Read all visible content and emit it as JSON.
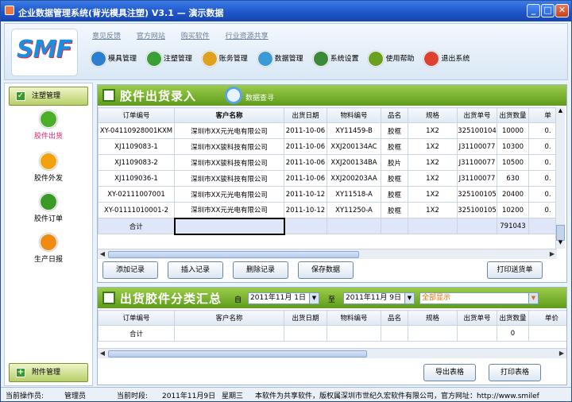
{
  "window": {
    "title": "企业数据管理系统(背光模具注塑) V3.1 — 演示数据",
    "min": "_",
    "max": "□",
    "close": "✕"
  },
  "logo": {
    "text": "SMF"
  },
  "links": [
    "意见反馈",
    "官方网站",
    "购买软件",
    "行业资源共享"
  ],
  "menu": [
    {
      "label": "模具管理",
      "icon": "mold-icon",
      "color": "#2a7fd0"
    },
    {
      "label": "注塑管理",
      "icon": "injection-icon",
      "color": "#3aa035"
    },
    {
      "label": "账务管理",
      "icon": "money-bag-icon",
      "color": "#e0a020"
    },
    {
      "label": "数据管理",
      "icon": "data-disc-icon",
      "color": "#3a9ad8"
    },
    {
      "label": "系统设置",
      "icon": "tools-icon",
      "color": "#3a8a3a"
    },
    {
      "label": "使用帮助",
      "icon": "help-icon",
      "color": "#6aa020"
    },
    {
      "label": "退出系统",
      "icon": "exit-icon",
      "color": "#e04030"
    }
  ],
  "sidebar": {
    "top_button": "注塑管理",
    "items": [
      {
        "label": "胶件出货",
        "color": "#4caf2a",
        "icon": "check-icon",
        "active": true
      },
      {
        "label": "胶件外发",
        "color": "#f3a20e",
        "icon": "person-walk-icon"
      },
      {
        "label": "胶件订单",
        "color": "#3a9a28",
        "icon": "money-icon"
      },
      {
        "label": "生产日报",
        "color": "#f08a10",
        "icon": "alert-icon"
      }
    ],
    "bottom_button": "附件管理"
  },
  "entry_panel": {
    "title": "胶件出货录入",
    "search_label": "数据查寻",
    "columns": [
      "订单编号",
      "客户名称",
      "出货日期",
      "物料编号",
      "品名",
      "规格",
      "出货单号",
      "出货数量",
      "单"
    ],
    "rows": [
      [
        "XY-04110928001KXM",
        "深圳市XX元光电有限公司",
        "2011-10-06",
        "XY11459-B",
        "胶框",
        "1X2",
        "325100104",
        "10000",
        "0."
      ],
      [
        "XJ1109083-1",
        "深圳市XX骏科技有限公司",
        "2011-10-06",
        "XXJ200134AC",
        "胶框",
        "1X2",
        "J31100077",
        "10300",
        "0."
      ],
      [
        "XJ1109083-2",
        "深圳市XX骏科技有限公司",
        "2011-10-06",
        "XXJ200134BA",
        "胶片",
        "1X2",
        "J31100077",
        "10500",
        "0."
      ],
      [
        "XJ1109036-1",
        "深圳市XX骏科技有限公司",
        "2011-10-06",
        "XXJ200203AA",
        "胶框",
        "1X2",
        "J31100077",
        "630",
        "0."
      ],
      [
        "XY-02111007001",
        "深圳市XX元光电有限公司",
        "2011-10-12",
        "XY11518-A",
        "胶框",
        "1X2",
        "325100105",
        "20400",
        "0."
      ],
      [
        "XY-01111010001-2",
        "深圳市XX元光电有限公司",
        "2011-10-12",
        "XY11250-A",
        "胶框",
        "1X2",
        "325100105",
        "10200",
        "0."
      ]
    ],
    "total_label": "合计",
    "total_qty": "791043",
    "buttons": [
      "添加记录",
      "插入记录",
      "删除记录",
      "保存数据"
    ],
    "print_button": "打印送货单"
  },
  "summary_panel": {
    "title": "出货胶件分类汇总",
    "date_from_label": "自",
    "date_from": "2011年11月 1日",
    "date_to_label": "至",
    "date_to": "2011年11月 9日",
    "filter": "全部显示",
    "columns": [
      "订单编号",
      "客户名称",
      "出货日期",
      "物料编号",
      "品名",
      "规格",
      "出货单号",
      "出货数量",
      "单价"
    ],
    "total_label": "合计",
    "total_qty": "0",
    "export_button": "导出表格",
    "print_button": "打印表格"
  },
  "status": {
    "operator_label": "当前操作员:",
    "operator": "管理员",
    "time_label": "当前时段:",
    "date": "2011年11月9日",
    "weekday": "星期三",
    "notice": "本软件为共享软件，版权属深圳市世纪久宏软件有限公司，官方网址：http://www.smilef"
  }
}
